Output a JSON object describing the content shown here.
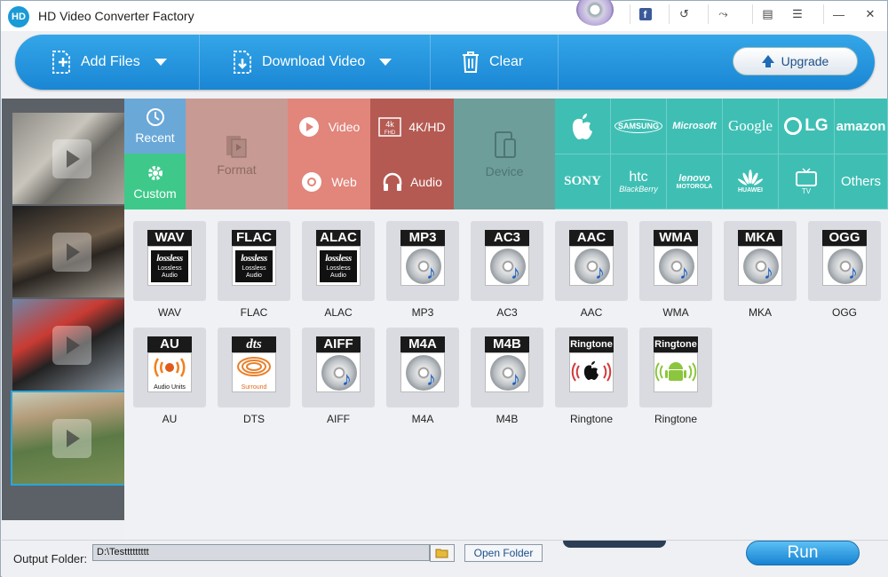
{
  "app": {
    "title": "HD Video Converter Factory",
    "logo_text": "HD"
  },
  "titlebar": {
    "buttons": [
      "facebook-icon",
      "undo-icon",
      "tools-icon",
      "feedback-icon",
      "list-icon",
      "minimize-icon",
      "close-icon"
    ]
  },
  "toolbar": {
    "add_files": "Add Files",
    "download_video": "Download Video",
    "clear": "Clear",
    "upgrade": "Upgrade"
  },
  "categories": {
    "recent": "Recent",
    "custom": "Custom",
    "format": "Format",
    "video": "Video",
    "hd": "4K/HD",
    "web": "Web",
    "audio": "Audio",
    "device": "Device"
  },
  "brands": {
    "row1": [
      "",
      "SAMSUNG",
      "Microsoft",
      "Google",
      "LG",
      "amazon"
    ],
    "row2": [
      "SONY",
      "htc",
      "lenovo",
      "HUAWEI",
      "TV",
      "Others"
    ],
    "htc_sub": "BlackBerry",
    "lenovo_sub": "MOTOROLA"
  },
  "formats": [
    {
      "header": "WAV",
      "name": "WAV",
      "kind": "lossless"
    },
    {
      "header": "FLAC",
      "name": "FLAC",
      "kind": "lossless"
    },
    {
      "header": "ALAC",
      "name": "ALAC",
      "kind": "lossless"
    },
    {
      "header": "MP3",
      "name": "MP3",
      "kind": "cd"
    },
    {
      "header": "AC3",
      "name": "AC3",
      "kind": "cd"
    },
    {
      "header": "AAC",
      "name": "AAC",
      "kind": "cd"
    },
    {
      "header": "WMA",
      "name": "WMA",
      "kind": "cd"
    },
    {
      "header": "MKA",
      "name": "MKA",
      "kind": "cd"
    },
    {
      "header": "OGG",
      "name": "OGG",
      "kind": "cd"
    },
    {
      "header": "AU",
      "name": "AU",
      "kind": "au"
    },
    {
      "header": "dts",
      "name": "DTS",
      "kind": "dts"
    },
    {
      "header": "AIFF",
      "name": "AIFF",
      "kind": "cd"
    },
    {
      "header": "M4A",
      "name": "M4A",
      "kind": "cd"
    },
    {
      "header": "M4B",
      "name": "M4B",
      "kind": "cd"
    },
    {
      "header": "Ringtone",
      "name": "Ringtone",
      "kind": "apple"
    },
    {
      "header": "Ringtone",
      "name": "Ringtone",
      "kind": "android"
    }
  ],
  "lossless_text": {
    "big": "lossless",
    "line1": "Lossless",
    "line2": "Audio"
  },
  "au_text": "Audio Units",
  "dts_text": "Surround",
  "output": {
    "label": "Output Folder:",
    "path": "D:\\Testtttttttt",
    "open_folder": "Open Folder",
    "run": "Run"
  },
  "colors": {
    "toolbar": "#1f8fdb",
    "recent": "#6aa8d8",
    "custom": "#3ec98a",
    "format": "#c79a93",
    "video_web": "#e2857b",
    "hd_audio": "#b55a52",
    "device": "#6e9e9a",
    "brands": "#3fbfb4"
  }
}
